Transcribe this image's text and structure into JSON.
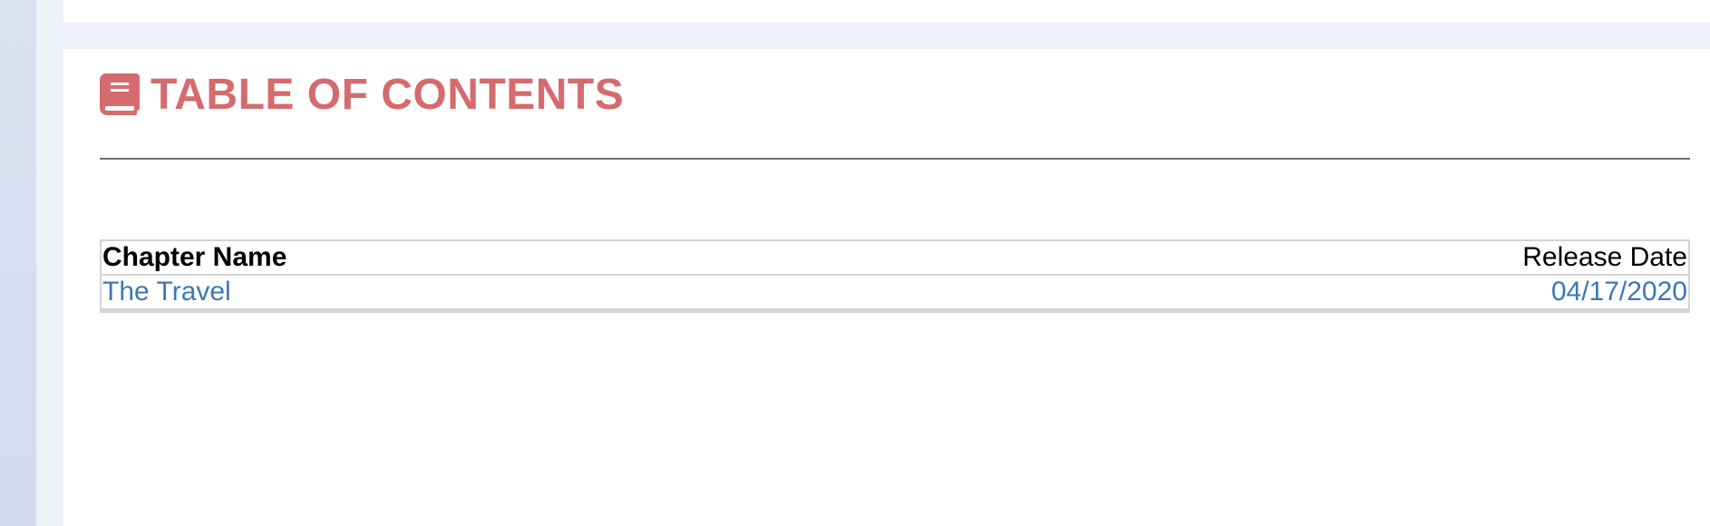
{
  "colors": {
    "heading": "#d56b6e",
    "link": "#3d78b3",
    "rule": "#6e6e6e",
    "table_border": "#d4d4d4",
    "page_bg": "#eef1f7",
    "left_strip": "#d6deef"
  },
  "toc": {
    "icon": "book-icon",
    "title": "TABLE OF CONTENTS",
    "columns": {
      "chapter": "Chapter Name",
      "release": "Release Date"
    },
    "rows": [
      {
        "chapter": "The Travel",
        "release": "04/17/2020"
      }
    ]
  }
}
